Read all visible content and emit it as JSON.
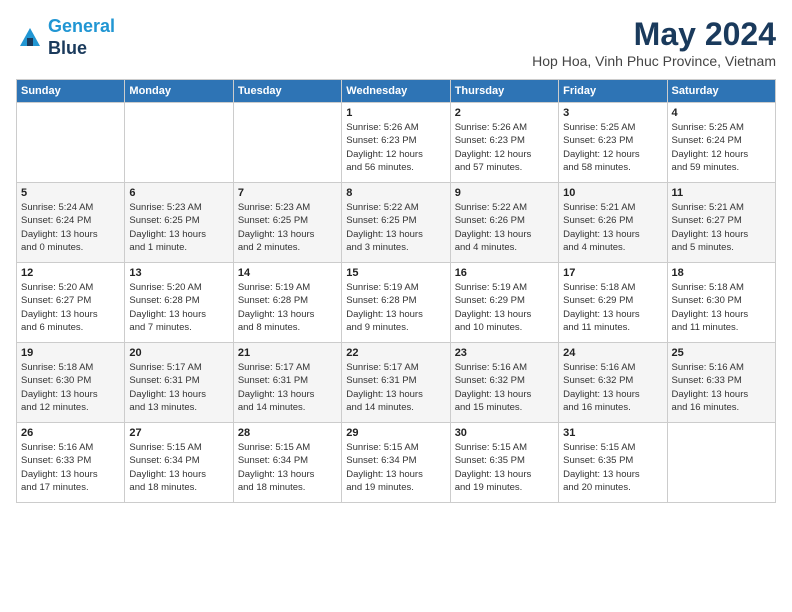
{
  "header": {
    "logo_line1": "General",
    "logo_line2": "Blue",
    "title": "May 2024",
    "subtitle": "Hop Hoa, Vinh Phuc Province, Vietnam"
  },
  "days_of_week": [
    "Sunday",
    "Monday",
    "Tuesday",
    "Wednesday",
    "Thursday",
    "Friday",
    "Saturday"
  ],
  "weeks": [
    {
      "cells": [
        {
          "day": "",
          "content": ""
        },
        {
          "day": "",
          "content": ""
        },
        {
          "day": "",
          "content": ""
        },
        {
          "day": "1",
          "content": "Sunrise: 5:26 AM\nSunset: 6:23 PM\nDaylight: 12 hours\nand 56 minutes."
        },
        {
          "day": "2",
          "content": "Sunrise: 5:26 AM\nSunset: 6:23 PM\nDaylight: 12 hours\nand 57 minutes."
        },
        {
          "day": "3",
          "content": "Sunrise: 5:25 AM\nSunset: 6:23 PM\nDaylight: 12 hours\nand 58 minutes."
        },
        {
          "day": "4",
          "content": "Sunrise: 5:25 AM\nSunset: 6:24 PM\nDaylight: 12 hours\nand 59 minutes."
        }
      ]
    },
    {
      "cells": [
        {
          "day": "5",
          "content": "Sunrise: 5:24 AM\nSunset: 6:24 PM\nDaylight: 13 hours\nand 0 minutes."
        },
        {
          "day": "6",
          "content": "Sunrise: 5:23 AM\nSunset: 6:25 PM\nDaylight: 13 hours\nand 1 minute."
        },
        {
          "day": "7",
          "content": "Sunrise: 5:23 AM\nSunset: 6:25 PM\nDaylight: 13 hours\nand 2 minutes."
        },
        {
          "day": "8",
          "content": "Sunrise: 5:22 AM\nSunset: 6:25 PM\nDaylight: 13 hours\nand 3 minutes."
        },
        {
          "day": "9",
          "content": "Sunrise: 5:22 AM\nSunset: 6:26 PM\nDaylight: 13 hours\nand 4 minutes."
        },
        {
          "day": "10",
          "content": "Sunrise: 5:21 AM\nSunset: 6:26 PM\nDaylight: 13 hours\nand 4 minutes."
        },
        {
          "day": "11",
          "content": "Sunrise: 5:21 AM\nSunset: 6:27 PM\nDaylight: 13 hours\nand 5 minutes."
        }
      ]
    },
    {
      "cells": [
        {
          "day": "12",
          "content": "Sunrise: 5:20 AM\nSunset: 6:27 PM\nDaylight: 13 hours\nand 6 minutes."
        },
        {
          "day": "13",
          "content": "Sunrise: 5:20 AM\nSunset: 6:28 PM\nDaylight: 13 hours\nand 7 minutes."
        },
        {
          "day": "14",
          "content": "Sunrise: 5:19 AM\nSunset: 6:28 PM\nDaylight: 13 hours\nand 8 minutes."
        },
        {
          "day": "15",
          "content": "Sunrise: 5:19 AM\nSunset: 6:28 PM\nDaylight: 13 hours\nand 9 minutes."
        },
        {
          "day": "16",
          "content": "Sunrise: 5:19 AM\nSunset: 6:29 PM\nDaylight: 13 hours\nand 10 minutes."
        },
        {
          "day": "17",
          "content": "Sunrise: 5:18 AM\nSunset: 6:29 PM\nDaylight: 13 hours\nand 11 minutes."
        },
        {
          "day": "18",
          "content": "Sunrise: 5:18 AM\nSunset: 6:30 PM\nDaylight: 13 hours\nand 11 minutes."
        }
      ]
    },
    {
      "cells": [
        {
          "day": "19",
          "content": "Sunrise: 5:18 AM\nSunset: 6:30 PM\nDaylight: 13 hours\nand 12 minutes."
        },
        {
          "day": "20",
          "content": "Sunrise: 5:17 AM\nSunset: 6:31 PM\nDaylight: 13 hours\nand 13 minutes."
        },
        {
          "day": "21",
          "content": "Sunrise: 5:17 AM\nSunset: 6:31 PM\nDaylight: 13 hours\nand 14 minutes."
        },
        {
          "day": "22",
          "content": "Sunrise: 5:17 AM\nSunset: 6:31 PM\nDaylight: 13 hours\nand 14 minutes."
        },
        {
          "day": "23",
          "content": "Sunrise: 5:16 AM\nSunset: 6:32 PM\nDaylight: 13 hours\nand 15 minutes."
        },
        {
          "day": "24",
          "content": "Sunrise: 5:16 AM\nSunset: 6:32 PM\nDaylight: 13 hours\nand 16 minutes."
        },
        {
          "day": "25",
          "content": "Sunrise: 5:16 AM\nSunset: 6:33 PM\nDaylight: 13 hours\nand 16 minutes."
        }
      ]
    },
    {
      "cells": [
        {
          "day": "26",
          "content": "Sunrise: 5:16 AM\nSunset: 6:33 PM\nDaylight: 13 hours\nand 17 minutes."
        },
        {
          "day": "27",
          "content": "Sunrise: 5:15 AM\nSunset: 6:34 PM\nDaylight: 13 hours\nand 18 minutes."
        },
        {
          "day": "28",
          "content": "Sunrise: 5:15 AM\nSunset: 6:34 PM\nDaylight: 13 hours\nand 18 minutes."
        },
        {
          "day": "29",
          "content": "Sunrise: 5:15 AM\nSunset: 6:34 PM\nDaylight: 13 hours\nand 19 minutes."
        },
        {
          "day": "30",
          "content": "Sunrise: 5:15 AM\nSunset: 6:35 PM\nDaylight: 13 hours\nand 19 minutes."
        },
        {
          "day": "31",
          "content": "Sunrise: 5:15 AM\nSunset: 6:35 PM\nDaylight: 13 hours\nand 20 minutes."
        },
        {
          "day": "",
          "content": ""
        }
      ]
    }
  ]
}
